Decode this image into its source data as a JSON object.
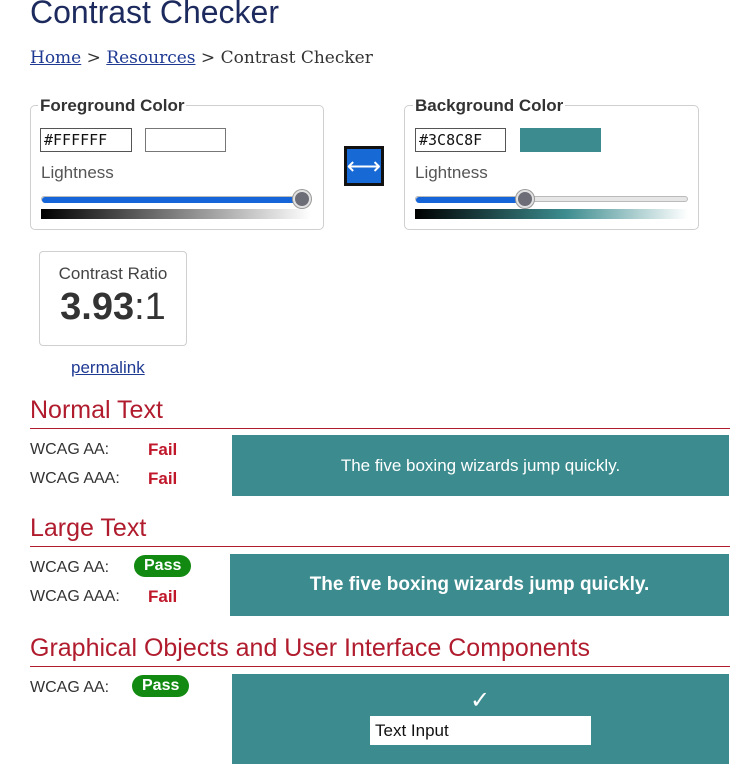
{
  "page": {
    "title": "Contrast Checker"
  },
  "breadcrumb": {
    "home": "Home",
    "sep1": ">",
    "resources": "Resources",
    "sep2": ">",
    "current": "Contrast Checker"
  },
  "foreground": {
    "legend": "Foreground Color",
    "hex": "#FFFFFF",
    "color": "#FFFFFF",
    "lightness_label": "Lightness",
    "lightness_percent": 100
  },
  "background": {
    "legend": "Background Color",
    "hex": "#3C8C8F",
    "color": "#3C8C8F",
    "lightness_label": "Lightness",
    "lightness_percent": 40
  },
  "swap": {
    "icon": "swap-arrows-icon",
    "glyph": "⟷"
  },
  "contrast": {
    "label": "Contrast Ratio",
    "value": "3.93",
    "suffix": ":1"
  },
  "permalink": "permalink",
  "normal_text": {
    "heading": "Normal Text",
    "aa_label": "WCAG AA:",
    "aa_result": "Fail",
    "aaa_label": "WCAG AAA:",
    "aaa_result": "Fail",
    "sample": "The five boxing wizards jump quickly."
  },
  "large_text": {
    "heading": "Large Text",
    "aa_label": "WCAG AA:",
    "aa_result": "Pass",
    "aaa_label": "WCAG AAA:",
    "aaa_result": "Fail",
    "sample": "The five boxing wizards jump quickly."
  },
  "graphical": {
    "heading": "Graphical Objects and User Interface Components",
    "aa_label": "WCAG AA:",
    "aa_result": "Pass",
    "check_glyph": "✓",
    "text_input_value": "Text Input"
  },
  "colors": {
    "accent_blue": "#1565D8",
    "heading_red": "#B01C2E",
    "pass_green": "#128A12",
    "fail_red": "#C0172B",
    "title_navy": "#1C2A5E"
  }
}
